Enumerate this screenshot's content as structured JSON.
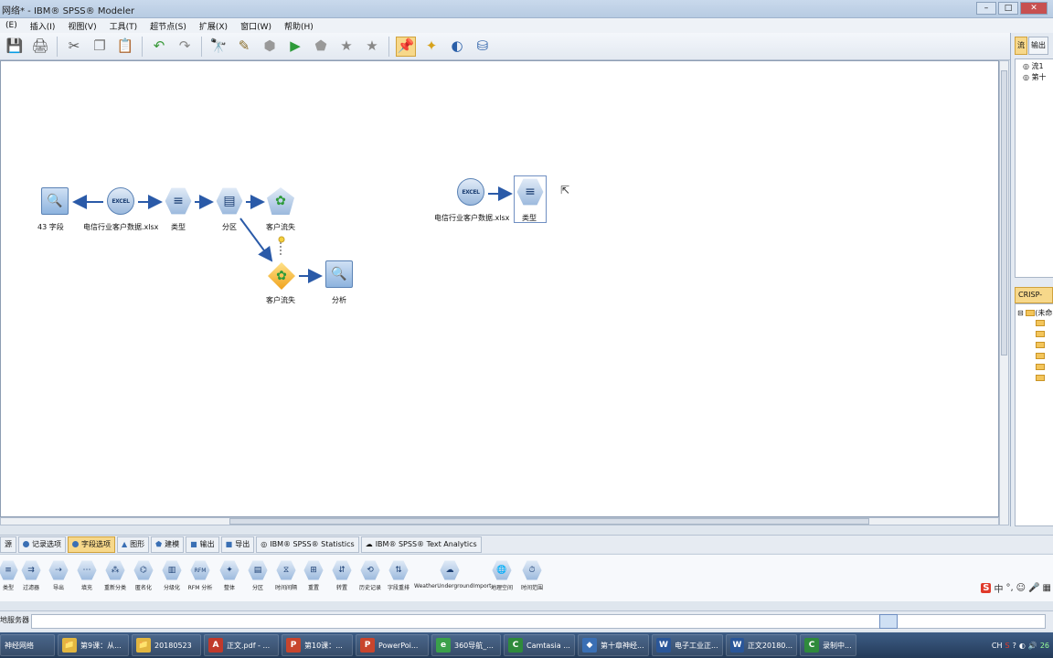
{
  "window": {
    "title": "网络* - IBM® SPSS® Modeler",
    "buttons": [
      "–",
      "□",
      "✕"
    ]
  },
  "menu": [
    "(E)",
    "插入(I)",
    "视图(V)",
    "工具(T)",
    "超节点(S)",
    "扩展(X)",
    "窗口(W)",
    "帮助(H)"
  ],
  "toolbar": {
    "icons": [
      "save-icon",
      "print-icon",
      "cut-icon",
      "copy-icon",
      "paste-icon",
      "undo-icon",
      "redo-icon",
      "find-icon",
      "edit-icon",
      "stop-icon",
      "run-icon",
      "supernode-icon",
      "star-icon",
      "star-icon-2",
      "pin-icon",
      "annotation-icon",
      "globe-icon",
      "server-icon"
    ],
    "glyphs": [
      "💾",
      "🖨",
      "✂",
      "❐",
      "📋",
      "↶",
      "↷",
      "🔭",
      "✎",
      "⬢",
      "▶",
      "⬟",
      "★",
      "★",
      "📌",
      "✦",
      "◐",
      "⛁"
    ]
  },
  "canvas": {
    "nodes": [
      {
        "id": "n1",
        "label": "43 字段",
        "shape": "square",
        "glyph": "🔍"
      },
      {
        "id": "n2",
        "label": "电信行业客户数据.xlsx",
        "shape": "circle",
        "glyph": "EXCEL"
      },
      {
        "id": "n3",
        "label": "类型",
        "shape": "hex",
        "glyph": "≡"
      },
      {
        "id": "n4",
        "label": "分区",
        "shape": "hex",
        "glyph": "▤"
      },
      {
        "id": "n5",
        "label": "客户流失",
        "shape": "penta",
        "glyph": "✿"
      },
      {
        "id": "n6",
        "label": "客户流失",
        "shape": "diamond",
        "glyph": "✿"
      },
      {
        "id": "n7",
        "label": "分析",
        "shape": "square",
        "glyph": "🔍"
      },
      {
        "id": "n8",
        "label": "电信行业客户数据.xlsx",
        "shape": "circle",
        "glyph": "EXCEL"
      },
      {
        "id": "n9",
        "label": "类型",
        "shape": "hex",
        "glyph": "≡"
      }
    ]
  },
  "right_panel": {
    "tabs": [
      "流",
      "输出"
    ],
    "streams": [
      "流1",
      "第十"
    ],
    "crisp_tab": "CRISP-DM",
    "crisp_root": "(未命名)"
  },
  "palette_tabs": [
    "源",
    "记录选项",
    "字段选项",
    "图形",
    "建模",
    "输出",
    "导出",
    "IBM® SPSS® Statistics",
    "IBM® SPSS® Text Analytics"
  ],
  "palette_tab_active": "字段选项",
  "palette_nodes": [
    {
      "label": "类型",
      "glyph": "≡"
    },
    {
      "label": "过滤器",
      "glyph": "⇉"
    },
    {
      "label": "导出",
      "glyph": "⇢"
    },
    {
      "label": "填充",
      "glyph": "⋯"
    },
    {
      "label": "重新分类",
      "glyph": "⁂"
    },
    {
      "label": "匿名化",
      "glyph": "⌬"
    },
    {
      "label": "分级化",
      "glyph": "▥"
    },
    {
      "label": "RFM 分析",
      "glyph": "RFM"
    },
    {
      "label": "整体",
      "glyph": "✦"
    },
    {
      "label": "分区",
      "glyph": "▤"
    },
    {
      "label": "时间间隔",
      "glyph": "⧖"
    },
    {
      "label": "重置",
      "glyph": "⊞"
    },
    {
      "label": "转置",
      "glyph": "⇵"
    },
    {
      "label": "历史记录",
      "glyph": "⟲"
    },
    {
      "label": "字段重排",
      "glyph": "⇅"
    },
    {
      "label": "WeatherUndergroundImport",
      "glyph": "☁"
    },
    {
      "label": "地理空间",
      "glyph": "🌐"
    },
    {
      "label": "时间范围",
      "glyph": "⏱"
    }
  ],
  "ime": {
    "logo": "S",
    "items": [
      "中",
      "°,",
      "☺",
      "🎤",
      "▦"
    ]
  },
  "status": {
    "server_label": "地服务器"
  },
  "taskbar": [
    {
      "label": "神经网络",
      "color": "#2b4a72",
      "icon": "神"
    },
    {
      "label": "第9课：从...",
      "color": "#e2b640",
      "icon": "📁"
    },
    {
      "label": "20180523",
      "color": "#e2b640",
      "icon": "📁"
    },
    {
      "label": "正文.pdf - ...",
      "color": "#c0392b",
      "icon": "A"
    },
    {
      "label": "第10课：...",
      "color": "#c8452d",
      "icon": "P"
    },
    {
      "label": "PowerPoi...",
      "color": "#c8452d",
      "icon": "P"
    },
    {
      "label": "360导航_...",
      "color": "#3aa04a",
      "icon": "e"
    },
    {
      "label": "Camtasia ...",
      "color": "#2f8a3c",
      "icon": "C"
    },
    {
      "label": "第十章神经...",
      "color": "#3a6fb4",
      "icon": "◆"
    },
    {
      "label": "电子工业正...",
      "color": "#2a5699",
      "icon": "W"
    },
    {
      "label": "正文20180...",
      "color": "#2a5699",
      "icon": "W"
    },
    {
      "label": "录制中...",
      "color": "#2f8a3c",
      "icon": "C"
    }
  ],
  "tray": [
    "CH",
    "S",
    "?",
    "◐",
    "🔊",
    "26"
  ]
}
